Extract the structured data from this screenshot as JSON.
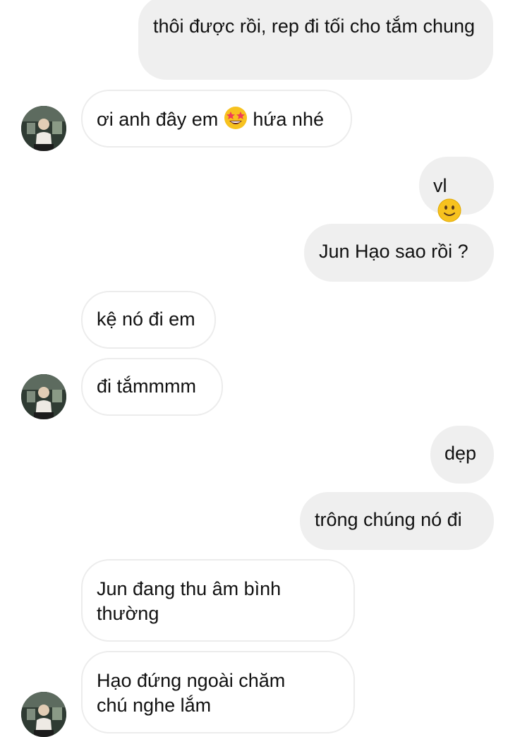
{
  "messages": [
    {
      "id": "m1",
      "text": "thôi được rồi, rep đi tối cho tắm chung"
    },
    {
      "id": "m2",
      "text_before": "ơi anh đây em",
      "emoji": "star-struck-emoji",
      "text_after": "hứa nhé"
    },
    {
      "id": "m3",
      "text": "vl",
      "emoji": "slightly-smiling-emoji"
    },
    {
      "id": "m4",
      "text": "Jun Hạo sao rồi ?"
    },
    {
      "id": "m5",
      "text": "kệ nó đi em"
    },
    {
      "id": "m6",
      "text": "đi tắmmmm"
    },
    {
      "id": "m7",
      "text": "dẹp"
    },
    {
      "id": "m8",
      "text": "trông chúng nó đi"
    },
    {
      "id": "m9",
      "text": "Jun đang thu âm bình thường"
    },
    {
      "id": "m10",
      "text": "Hạo đứng ngoài chăm chú nghe lắm"
    }
  ],
  "colors": {
    "outgoing_bubble": "#efefef",
    "incoming_border": "#ececec",
    "text": "#111111"
  }
}
